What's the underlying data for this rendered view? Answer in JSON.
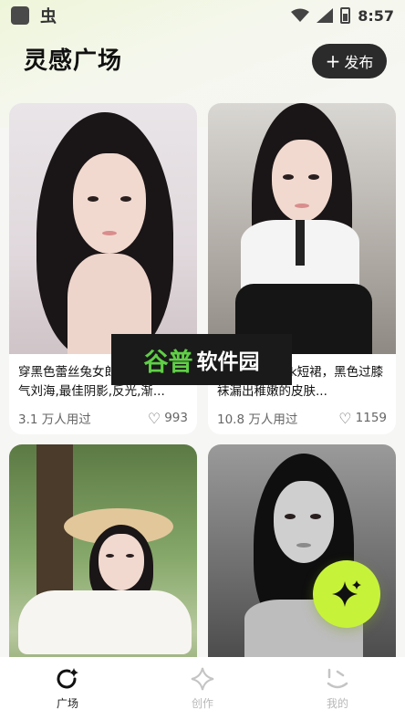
{
  "status_bar": {
    "time": "8:57",
    "app_glyph": "虫"
  },
  "header": {
    "title": "灵感广场",
    "publish_label": "发布"
  },
  "cards": [
    {
      "desc": "穿黑色蕾丝兔女郎，长发垂至气刘海,最佳阴影,反光,渐...",
      "views": "3.1 万人用过",
      "likes": "993"
    },
    {
      "desc": "1少女，穿着jk短裙，黑色过膝袜漏出稚嫩的皮肤...",
      "views": "10.8 万人用过",
      "likes": "1159"
    },
    {
      "desc": "",
      "views": "",
      "likes": ""
    },
    {
      "desc": "",
      "views": "",
      "likes": ""
    }
  ],
  "watermark": {
    "green": "谷普",
    "white": "软件园"
  },
  "bottom_nav": [
    {
      "label": "广场",
      "icon": "plaza-icon",
      "active": true
    },
    {
      "label": "创作",
      "icon": "sparkle-icon",
      "active": false
    },
    {
      "label": "我的",
      "icon": "face-icon",
      "active": false
    }
  ],
  "colors": {
    "accent": "#c7f23a",
    "dark_button": "#2b2b2b"
  }
}
